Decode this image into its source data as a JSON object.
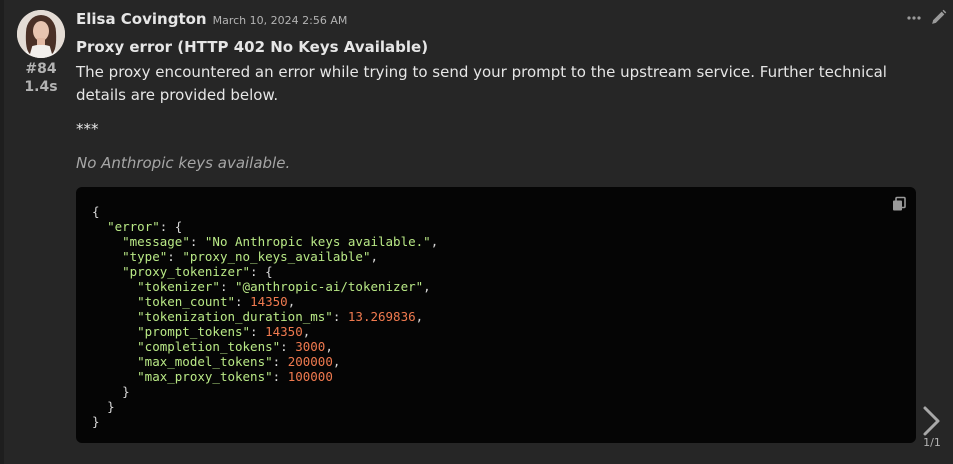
{
  "message": {
    "author": "Elisa Covington",
    "timestamp": "March 10, 2024 2:56 AM",
    "id_label": "#84",
    "time_label": "1.4s",
    "title": "Proxy error (HTTP 402 No Keys Available)",
    "body": "The proxy encountered an error while trying to send your prompt to the upstream service. Further technical details are provided below.",
    "separator": "***",
    "note": "No Anthropic keys available."
  },
  "code": {
    "open_brace": "{",
    "error_key": "\"error\"",
    "message_key": "\"message\"",
    "message_value": "\"No Anthropic keys available.\"",
    "type_key": "\"type\"",
    "type_value": "\"proxy_no_keys_available\"",
    "proxy_tokenizer_key": "\"proxy_tokenizer\"",
    "tokenizer_key": "\"tokenizer\"",
    "tokenizer_value": "\"@anthropic-ai/tokenizer\"",
    "token_count_key": "\"token_count\"",
    "token_count_value": "14350",
    "tokenization_duration_key": "\"tokenization_duration_ms\"",
    "tokenization_duration_value": "13.269836",
    "prompt_tokens_key": "\"prompt_tokens\"",
    "prompt_tokens_value": "14350",
    "completion_tokens_key": "\"completion_tokens\"",
    "completion_tokens_value": "3000",
    "max_model_tokens_key": "\"max_model_tokens\"",
    "max_model_tokens_value": "200000",
    "max_proxy_tokens_key": "\"max_proxy_tokens\"",
    "max_proxy_tokens_value": "100000",
    "close_brace": "}"
  },
  "pager": {
    "label": "1/1"
  },
  "icons": {
    "more": "ellipsis-icon",
    "edit": "pencil-icon",
    "copy": "copy-icon",
    "next": "chevron-right-icon"
  },
  "colors": {
    "background": "#262626",
    "code_background": "#050505",
    "string": "#b9e986",
    "number": "#f07a4f"
  }
}
